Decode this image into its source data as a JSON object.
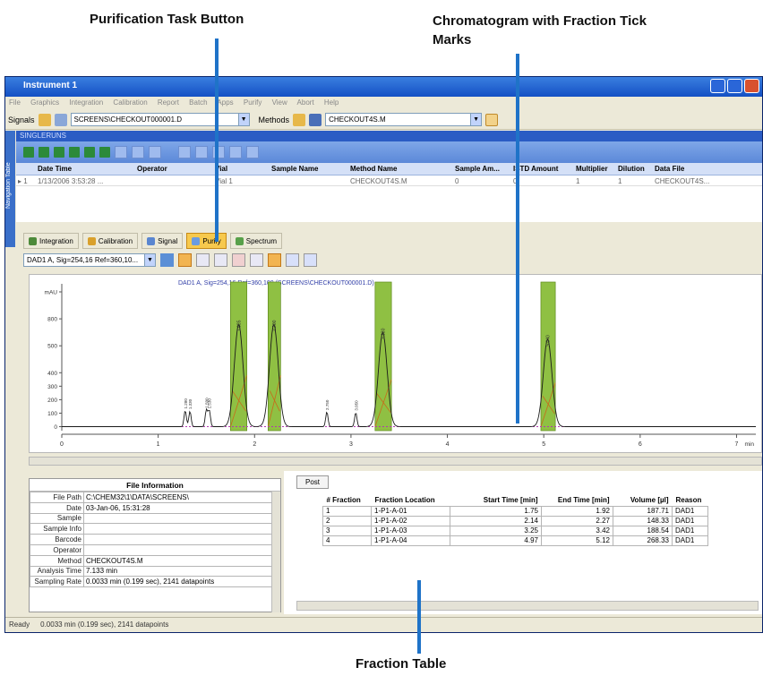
{
  "callouts": {
    "purify": "Purification Task Button",
    "chromatogram_line1": "Chromatogram with Fraction Tick",
    "chromatogram_line2": "Marks",
    "fraction_table": "Fraction Table"
  },
  "window": {
    "title": "Instrument 1",
    "menu": [
      "File",
      "Graphics",
      "Integration",
      "Calibration",
      "Report",
      "Batch",
      "Apps",
      "Purify",
      "View",
      "Abort",
      "Help"
    ]
  },
  "toolbar": {
    "signals_label": "Signals",
    "signal_file": "SCREENS\\CHECKOUT000001.D",
    "methods_label": "Methods",
    "method_file": "CHECKOUT4S.M"
  },
  "sidebar_tab": "Navigation Table",
  "sequence": {
    "header": "SINGLERUNS",
    "columns": [
      "Date Time",
      "Operator",
      "Vial",
      "Sample Name",
      "Method Name",
      "Sample Am...",
      "ISTD Amount",
      "Multiplier",
      "Dilution",
      "Data File"
    ],
    "row": [
      "1/13/2006 3:53:28 ...",
      "",
      "Vial 1",
      "",
      "CHECKOUT4S.M",
      "0",
      "0",
      "1",
      "1",
      "CHECKOUT4S..."
    ]
  },
  "tabs": [
    {
      "label": "Integration"
    },
    {
      "label": "Calibration"
    },
    {
      "label": "Signal"
    },
    {
      "label": "Purify"
    },
    {
      "label": "Spectrum"
    }
  ],
  "signal_select": "DAD1 A, Sig=254,16 Ref=360,10...",
  "chart_data": {
    "type": "line",
    "title": "DAD1 A, Sig=254,16 Ref=360,100 (SCREENS\\CHECKOUT000001.D)",
    "ylabel": "mAU",
    "xlabel": "min",
    "xlim": [
      0,
      7.2
    ],
    "ylim": [
      -30,
      1020
    ],
    "yticks": [
      "mAU",
      "800",
      "500",
      "400",
      "300",
      "200",
      "100",
      "0"
    ],
    "ytick_values": [
      1000,
      800,
      600,
      400,
      300,
      200,
      100,
      0
    ],
    "xticks": [
      0,
      1,
      2,
      3,
      4,
      5,
      6,
      7
    ],
    "fractions": [
      {
        "start": 1.75,
        "end": 1.92
      },
      {
        "start": 2.14,
        "end": 2.27
      },
      {
        "start": 3.25,
        "end": 3.42
      },
      {
        "start": 4.97,
        "end": 5.12
      }
    ],
    "peaks": [
      {
        "rt": 1.835,
        "height": 760
      },
      {
        "rt": 2.2,
        "height": 760
      },
      {
        "rt": 3.33,
        "height": 700
      },
      {
        "rt": 5.04,
        "height": 650
      }
    ],
    "small_peaks": [
      {
        "rt": 1.28,
        "height": 120
      },
      {
        "rt": 1.33,
        "height": 115
      },
      {
        "rt": 1.5,
        "height": 125
      },
      {
        "rt": 1.53,
        "height": 120
      },
      {
        "rt": 2.75,
        "height": 110
      },
      {
        "rt": 3.05,
        "height": 105
      }
    ]
  },
  "file_info": {
    "header": "File Information",
    "rows": [
      {
        "key": "File Path",
        "value": "C:\\CHEM32\\1\\DATA\\SCREENS\\"
      },
      {
        "key": "Date",
        "value": "03-Jan-06, 15:31:28"
      },
      {
        "key": "Sample",
        "value": ""
      },
      {
        "key": "Sample Info",
        "value": ""
      },
      {
        "key": "Barcode",
        "value": ""
      },
      {
        "key": "Operator",
        "value": ""
      },
      {
        "key": "Method",
        "value": "CHECKOUT4S.M"
      },
      {
        "key": "Analysis Time",
        "value": "7.133 min"
      },
      {
        "key": "Sampling Rate",
        "value": "0.0033 min (0.199 sec), 2141 datapoints"
      }
    ]
  },
  "fractions": {
    "post_button": "Post",
    "columns": [
      "# Fraction",
      "Fraction Location",
      "Start Time [min]",
      "End Time [min]",
      "Volume [µl]",
      "Reason"
    ],
    "rows": [
      [
        "1",
        "1-P1-A-01",
        "1.75",
        "1.92",
        "187.71",
        "DAD1"
      ],
      [
        "2",
        "1-P1-A-02",
        "2.14",
        "2.27",
        "148.33",
        "DAD1"
      ],
      [
        "3",
        "1-P1-A-03",
        "3.25",
        "3.42",
        "188.54",
        "DAD1"
      ],
      [
        "4",
        "1-P1-A-04",
        "4.97",
        "5.12",
        "268.33",
        "DAD1"
      ]
    ]
  },
  "status": {
    "state": "Ready",
    "info": "0.0033 min (0.199 sec), 2141 datapoints"
  },
  "colors": {
    "fraction_fill": "#8fc043",
    "trace": "#1a1a1a",
    "callout_line": "#1f73c8"
  }
}
